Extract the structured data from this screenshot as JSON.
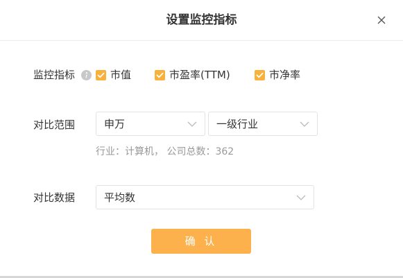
{
  "dialog": {
    "title": "设置监控指标",
    "close_icon": "close-icon"
  },
  "indicators": {
    "label": "监控指标",
    "info_icon": "info-icon",
    "options": [
      {
        "label": "市值",
        "checked": true
      },
      {
        "label": "市盈率(TTM)",
        "checked": true
      },
      {
        "label": "市净率",
        "checked": true
      }
    ]
  },
  "scope": {
    "label": "对比范围",
    "classification_value": "申万",
    "industry_level_value": "一级行业",
    "hint": "行业：计算机， 公司总数：362"
  },
  "compare": {
    "label": "对比数据",
    "value": "平均数"
  },
  "confirm_label": "确 认",
  "colors": {
    "accent": "#fdb14d",
    "checkbox": "#f9b13c",
    "hint_text": "#999999"
  }
}
